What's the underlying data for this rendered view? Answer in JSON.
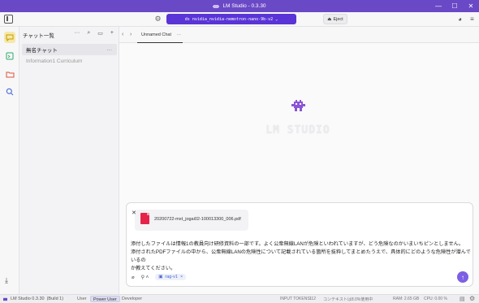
{
  "window": {
    "title": "LM Studio - 0.3.30",
    "controls": [
      "—",
      "☐",
      "✕"
    ]
  },
  "toolbar": {
    "model_name": "nvidia_nvidia-nemotron-nano-9b-v2",
    "model_prefix": "ds",
    "model_chevron": "⌄",
    "eject_label": "Eject"
  },
  "chatlist": {
    "header": "チャット一覧",
    "items": [
      {
        "label": "無名チャット",
        "more": "···"
      },
      {
        "label": "Information1 Curriculum"
      }
    ]
  },
  "tabs": [
    {
      "label": "Unnamed Chat",
      "more": "···"
    }
  ],
  "watermark": "LM STUDIO",
  "input": {
    "attachment_name": "20200722-mxt_jogai02-100013300_006.pdf",
    "message_lines": [
      "添付したファイルは情報1の教員向け研修資料の一部です。よく公衆無線LANが危険といわれていますが、どう危険なのかいまいちピンとしません。",
      "添付されたPDFファイルの中から、公衆無線LANの危険性について記載されている箇所を抜粋してまとめたうえで、具体的にどのような危険性が潜んでいるの",
      "か教えてください。"
    ],
    "rag_label": "rag-v1",
    "rag_close": "×"
  },
  "statusbar": {
    "app_version": "LM Studio 0.3.30",
    "build": "(Build 1)",
    "modes": [
      "User",
      "Power User",
      "Developer"
    ],
    "active_mode": "Power User",
    "input_tokens_label": "INPUT TOKENS:",
    "input_tokens_value": "112",
    "context_usage": "コンテキストは8.0%使用中",
    "ram": "RAM: 2.65 GB",
    "cpu": "CPU: 0.00 %"
  },
  "colors": {
    "accent": "#5a34d6",
    "titlebar": "#6a49c6",
    "send": "#7d5fe3",
    "pdf": "#e6234a"
  }
}
